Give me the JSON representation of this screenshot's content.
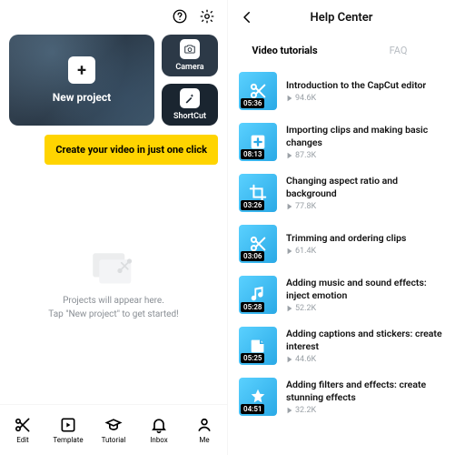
{
  "left": {
    "new_project_label": "New project",
    "camera_label": "Camera",
    "shortcut_label": "ShortCut",
    "cta": "Create your video in just one click",
    "empty_line1": "Projects will appear here.",
    "empty_line2": "Tap \"New project\" to get started!",
    "tabs": [
      {
        "label": "Edit",
        "icon": "scissors"
      },
      {
        "label": "Template",
        "icon": "template"
      },
      {
        "label": "Tutorial",
        "icon": "tutorial"
      },
      {
        "label": "Inbox",
        "icon": "bell"
      },
      {
        "label": "Me",
        "icon": "person"
      }
    ]
  },
  "right": {
    "title": "Help Center",
    "tab_active": "Video tutorials",
    "tab_inactive": "FAQ",
    "items": [
      {
        "title": "Introduction to the CapCut editor",
        "views": "94.6K",
        "dur": "05:36",
        "icon": "scissors"
      },
      {
        "title": "Importing clips and making basic changes",
        "views": "87.3K",
        "dur": "08:13",
        "icon": "plus"
      },
      {
        "title": "Changing aspect ratio and background",
        "views": "77.8K",
        "dur": "03:26",
        "icon": "crop"
      },
      {
        "title": "Trimming and ordering clips",
        "views": "61.4K",
        "dur": "03:06",
        "icon": "scissors"
      },
      {
        "title": "Adding music and sound effects: inject emotion",
        "views": "52.2K",
        "dur": "05:28",
        "icon": "music"
      },
      {
        "title": "Adding captions and stickers: create interest",
        "views": "44.6K",
        "dur": "05:25",
        "icon": "sticker"
      },
      {
        "title": "Adding filters and effects: create stunning effects",
        "views": "32.2K",
        "dur": "04:51",
        "icon": "star"
      }
    ]
  }
}
